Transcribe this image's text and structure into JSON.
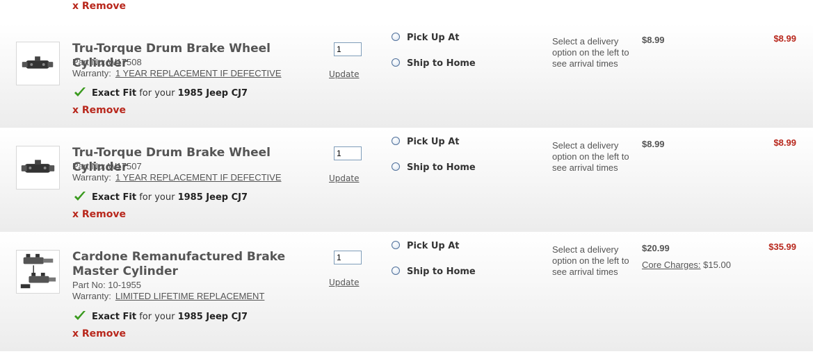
{
  "top": {
    "remove_label": "x Remove"
  },
  "items": [
    {
      "title": "Tru-Torque Drum Brake Wheel Cylinder",
      "part_no": "Part No: W17508",
      "warranty_label": "Warranty:",
      "warranty_value": "1 YEAR REPLACEMENT IF DEFECTIVE",
      "fit_label": "Exact Fit",
      "fit_for": "for your",
      "vehicle": "1985 Jeep CJ7",
      "remove_label": "x Remove",
      "qty": "1",
      "update_label": "Update",
      "pickup_label": "Pick Up At",
      "ship_label": "Ship to Home",
      "delivery_note": "Select a delivery option on the left to see arrival times",
      "unit_price": "$8.99",
      "total_price": "$8.99"
    },
    {
      "title": "Tru-Torque Drum Brake Wheel Cylinder",
      "part_no": "Part No: W17507",
      "warranty_label": "Warranty:",
      "warranty_value": "1 YEAR REPLACEMENT IF DEFECTIVE",
      "fit_label": "Exact Fit",
      "fit_for": "for your",
      "vehicle": "1985 Jeep CJ7",
      "remove_label": "x Remove",
      "qty": "1",
      "update_label": "Update",
      "pickup_label": "Pick Up At",
      "ship_label": "Ship to Home",
      "delivery_note": "Select a delivery option on the left to see arrival times",
      "unit_price": "$8.99",
      "total_price": "$8.99"
    },
    {
      "title": "Cardone Remanufactured Brake Master Cylinder",
      "part_no": "Part No: 10-1955",
      "warranty_label": "Warranty:",
      "warranty_value": "LIMITED LIFETIME REPLACEMENT",
      "fit_label": "Exact Fit",
      "fit_for": "for your",
      "vehicle": "1985 Jeep CJ7",
      "remove_label": "x Remove",
      "qty": "1",
      "update_label": "Update",
      "pickup_label": "Pick Up At",
      "ship_label": "Ship to Home",
      "delivery_note": "Select a delivery option on the left to see arrival times",
      "unit_price": "$20.99",
      "core_label": "Core Charges:",
      "core_value": "$15.00",
      "total_price": "$35.99"
    }
  ],
  "colors": {
    "accent_red": "#b8271c",
    "check_green": "#3a9a1e"
  },
  "icons": {
    "fit": "checkmark-icon",
    "product": "product-thumbnail"
  }
}
